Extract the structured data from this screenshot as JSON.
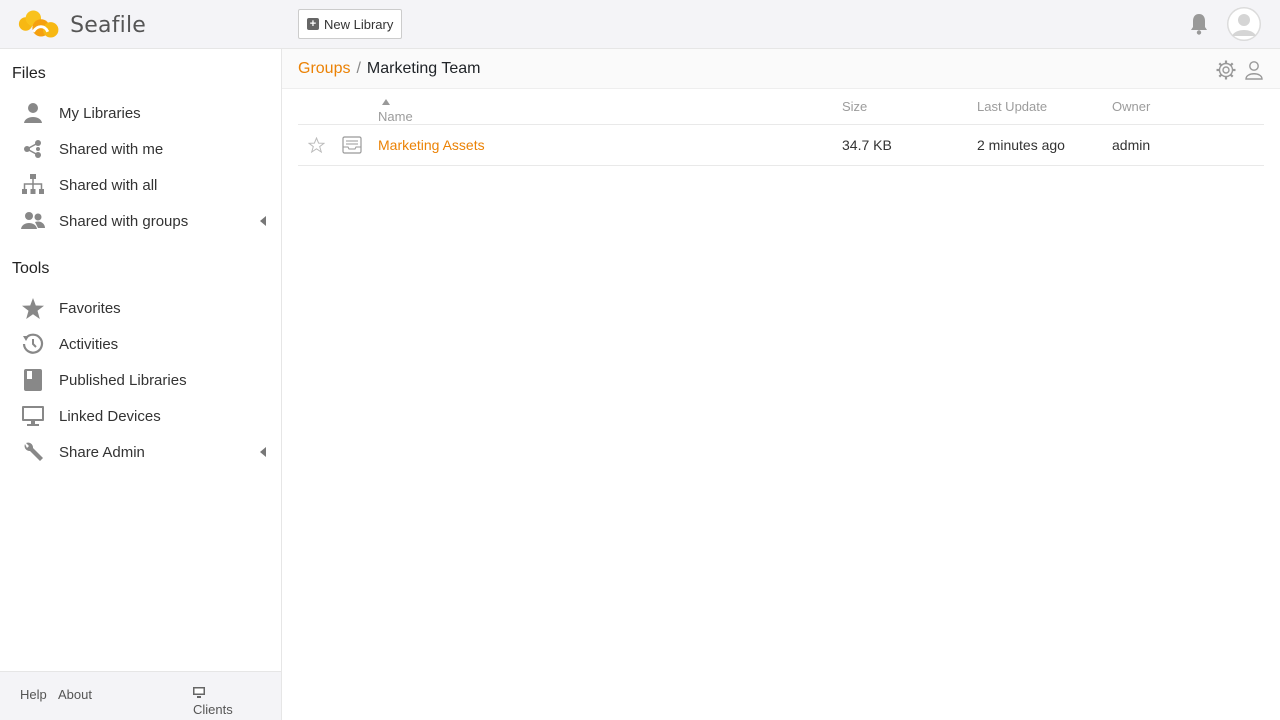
{
  "brand": {
    "name_prefix": "Sea",
    "name_suffix": "file"
  },
  "header": {
    "new_library_label": "New Library"
  },
  "sidebar": {
    "files_title": "Files",
    "files_items": [
      {
        "label": "My Libraries",
        "icon": "user-icon"
      },
      {
        "label": "Shared with me",
        "icon": "share-icon"
      },
      {
        "label": "Shared with all",
        "icon": "org-chart-icon"
      },
      {
        "label": "Shared with groups",
        "icon": "group-icon"
      }
    ],
    "tools_title": "Tools",
    "tools_items": [
      {
        "label": "Favorites",
        "icon": "star-icon"
      },
      {
        "label": "Activities",
        "icon": "history-icon"
      },
      {
        "label": "Published Libraries",
        "icon": "book-icon"
      },
      {
        "label": "Linked Devices",
        "icon": "monitor-icon"
      },
      {
        "label": "Share Admin",
        "icon": "wrench-icon"
      }
    ],
    "footer": {
      "help": "Help",
      "about": "About",
      "clients": "Clients"
    }
  },
  "breadcrumb": {
    "parent": "Groups",
    "separator": "/",
    "current": "Marketing Team"
  },
  "table": {
    "columns": {
      "name": "Name",
      "size": "Size",
      "last_update": "Last Update",
      "owner": "Owner"
    },
    "rows": [
      {
        "name": "Marketing Assets",
        "size": "34.7 KB",
        "last_update": "2 minutes ago",
        "owner": "admin"
      }
    ]
  },
  "colors": {
    "accent": "#eb8205",
    "icon_gray": "#888888"
  }
}
